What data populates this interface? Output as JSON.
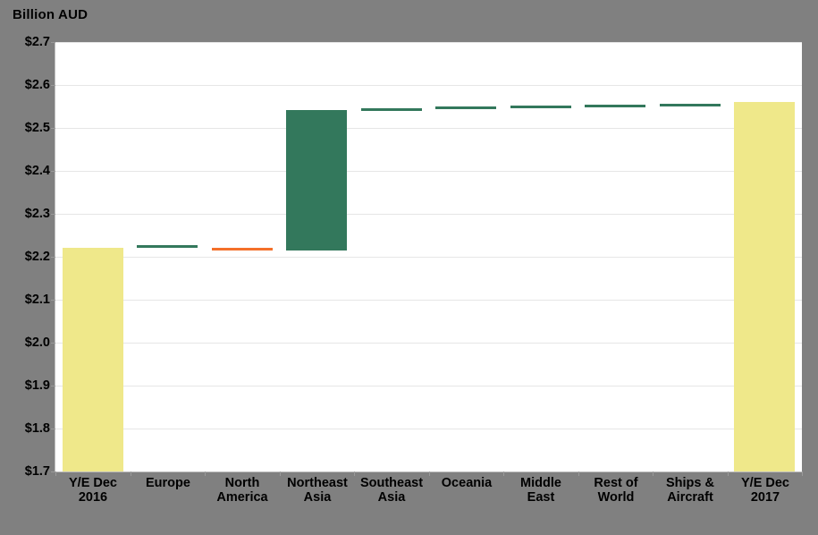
{
  "title": "Billion AUD",
  "colors": {
    "background": "#808080",
    "plot_background": "#ffffff",
    "total_bar": "#efe88a",
    "increase_bar": "#33785c",
    "decrease_bar": "#f4702a",
    "gridline": "#e6e6e6",
    "axis": "#bdbdbd",
    "text": "#000000"
  },
  "yaxis": {
    "ticks": [
      "$2.7",
      "$2.6",
      "$2.5",
      "$2.4",
      "$2.3",
      "$2.2",
      "$2.1",
      "$2.0",
      "$1.9",
      "$1.8",
      "$1.7"
    ],
    "values": [
      2.7,
      2.6,
      2.5,
      2.4,
      2.3,
      2.2,
      2.1,
      2.0,
      1.9,
      1.8,
      1.7
    ]
  },
  "xaxis": {
    "labels": [
      {
        "line1": "Y/E Dec",
        "line2": "2016"
      },
      {
        "line1": "Europe",
        "line2": ""
      },
      {
        "line1": "North",
        "line2": "America"
      },
      {
        "line1": "Northeast",
        "line2": "Asia"
      },
      {
        "line1": "Southeast",
        "line2": "Asia"
      },
      {
        "line1": "Oceania",
        "line2": ""
      },
      {
        "line1": "Middle",
        "line2": "East"
      },
      {
        "line1": "Rest of",
        "line2": "World"
      },
      {
        "line1": "Ships &",
        "line2": "Aircraft"
      },
      {
        "line1": "Y/E Dec",
        "line2": "2017"
      }
    ]
  },
  "chart_data": {
    "type": "bar",
    "subtype": "waterfall",
    "title": "Billion AUD",
    "xlabel": "",
    "ylabel": "Billion AUD",
    "ylim": [
      1.7,
      2.7
    ],
    "ytick_step": 0.1,
    "grid": true,
    "legend": "none",
    "categories": [
      "Y/E Dec 2016",
      "Europe",
      "North America",
      "Northeast Asia",
      "Southeast Asia",
      "Oceania",
      "Middle East",
      "Rest of World",
      "Ships & Aircraft",
      "Y/E Dec 2017"
    ],
    "bar_kinds": [
      "total",
      "increase",
      "decrease",
      "increase",
      "increase",
      "increase",
      "increase",
      "increase",
      "increase",
      "total"
    ],
    "deltas": [
      2.22,
      0.007,
      -0.005,
      0.327,
      0.004,
      0.004,
      0.002,
      0.002,
      0.002,
      2.56
    ],
    "cumulative_start": [
      1.7,
      2.22,
      2.215,
      2.215,
      2.542,
      2.546,
      2.55,
      2.552,
      2.554,
      1.7
    ],
    "cumulative_end": [
      2.22,
      2.227,
      2.22,
      2.542,
      2.546,
      2.55,
      2.552,
      2.554,
      2.556,
      2.56
    ],
    "values": [
      2.22,
      2.227,
      2.22,
      2.542,
      2.546,
      2.55,
      2.552,
      2.554,
      2.556,
      2.56
    ]
  }
}
